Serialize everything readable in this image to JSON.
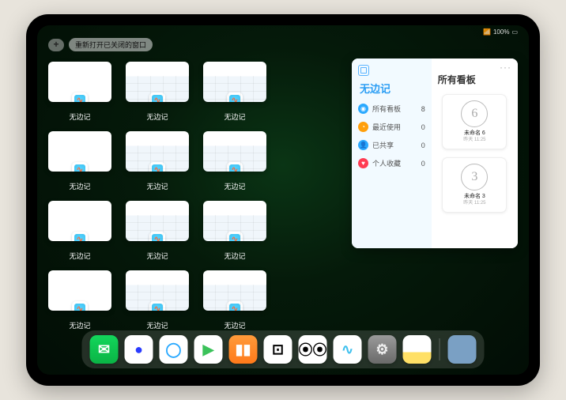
{
  "status": {
    "signal": "●●●●",
    "battery": "100%"
  },
  "top_bar": {
    "add_label": "+",
    "reopen_label": "重新打开已关闭的窗口"
  },
  "windows": [
    {
      "label": "无边记",
      "style": "blank"
    },
    {
      "label": "无边记",
      "style": "cal"
    },
    {
      "label": "无边记",
      "style": "cal"
    },
    {
      "label": "无边记",
      "style": "blank"
    },
    {
      "label": "无边记",
      "style": "cal"
    },
    {
      "label": "无边记",
      "style": "cal"
    },
    {
      "label": "无边记",
      "style": "blank"
    },
    {
      "label": "无边记",
      "style": "cal"
    },
    {
      "label": "无边记",
      "style": "cal"
    },
    {
      "label": "无边记",
      "style": "blank"
    },
    {
      "label": "无边记",
      "style": "cal"
    },
    {
      "label": "无边记",
      "style": "cal"
    }
  ],
  "large_window": {
    "left": {
      "title": "无边记",
      "rows": [
        {
          "icon_color": "#2aa9ff",
          "label": "所有看板",
          "count": "8"
        },
        {
          "icon_color": "#ff9f0a",
          "label": "最近使用",
          "count": "0"
        },
        {
          "icon_color": "#2aa9ff",
          "label": "已共享",
          "count": "0"
        },
        {
          "icon_color": "#ff3b52",
          "label": "个人收藏",
          "count": "0"
        }
      ]
    },
    "right": {
      "more": "···",
      "title": "所有看板",
      "boards": [
        {
          "sketch": "6",
          "name": "未命名 6",
          "time": "昨天 11:25"
        },
        {
          "sketch": "3",
          "name": "未命名 3",
          "time": "昨天 11:25"
        }
      ]
    }
  },
  "dock": [
    {
      "name": "wechat",
      "bg": "linear-gradient(#13d65b,#0ab445)",
      "glyph": "✉",
      "color": "#fff"
    },
    {
      "name": "quark",
      "bg": "#fff",
      "glyph": "●",
      "color": "#2a3cff"
    },
    {
      "name": "browser",
      "bg": "#fff",
      "glyph": "◯",
      "color": "#2aa9ff"
    },
    {
      "name": "play",
      "bg": "#fff",
      "glyph": "▶",
      "color": "#3bc25a"
    },
    {
      "name": "books",
      "bg": "linear-gradient(#ff9a3a,#ff7a1a)",
      "glyph": "▮▮",
      "color": "#fff"
    },
    {
      "name": "dice",
      "bg": "#fff",
      "glyph": "⊡",
      "color": "#000"
    },
    {
      "name": "connect",
      "bg": "#fff",
      "glyph": "⦿⦿",
      "color": "#000"
    },
    {
      "name": "freeform",
      "bg": "#fff",
      "glyph": "∿",
      "color": "#3fc0ee"
    },
    {
      "name": "settings",
      "bg": "linear-gradient(#9a9a9a,#6a6a6a)",
      "glyph": "⚙",
      "color": "#eee"
    },
    {
      "name": "notes",
      "bg": "linear-gradient(#fff 60%,#ffe066 60%)",
      "glyph": "",
      "color": "#000"
    }
  ]
}
